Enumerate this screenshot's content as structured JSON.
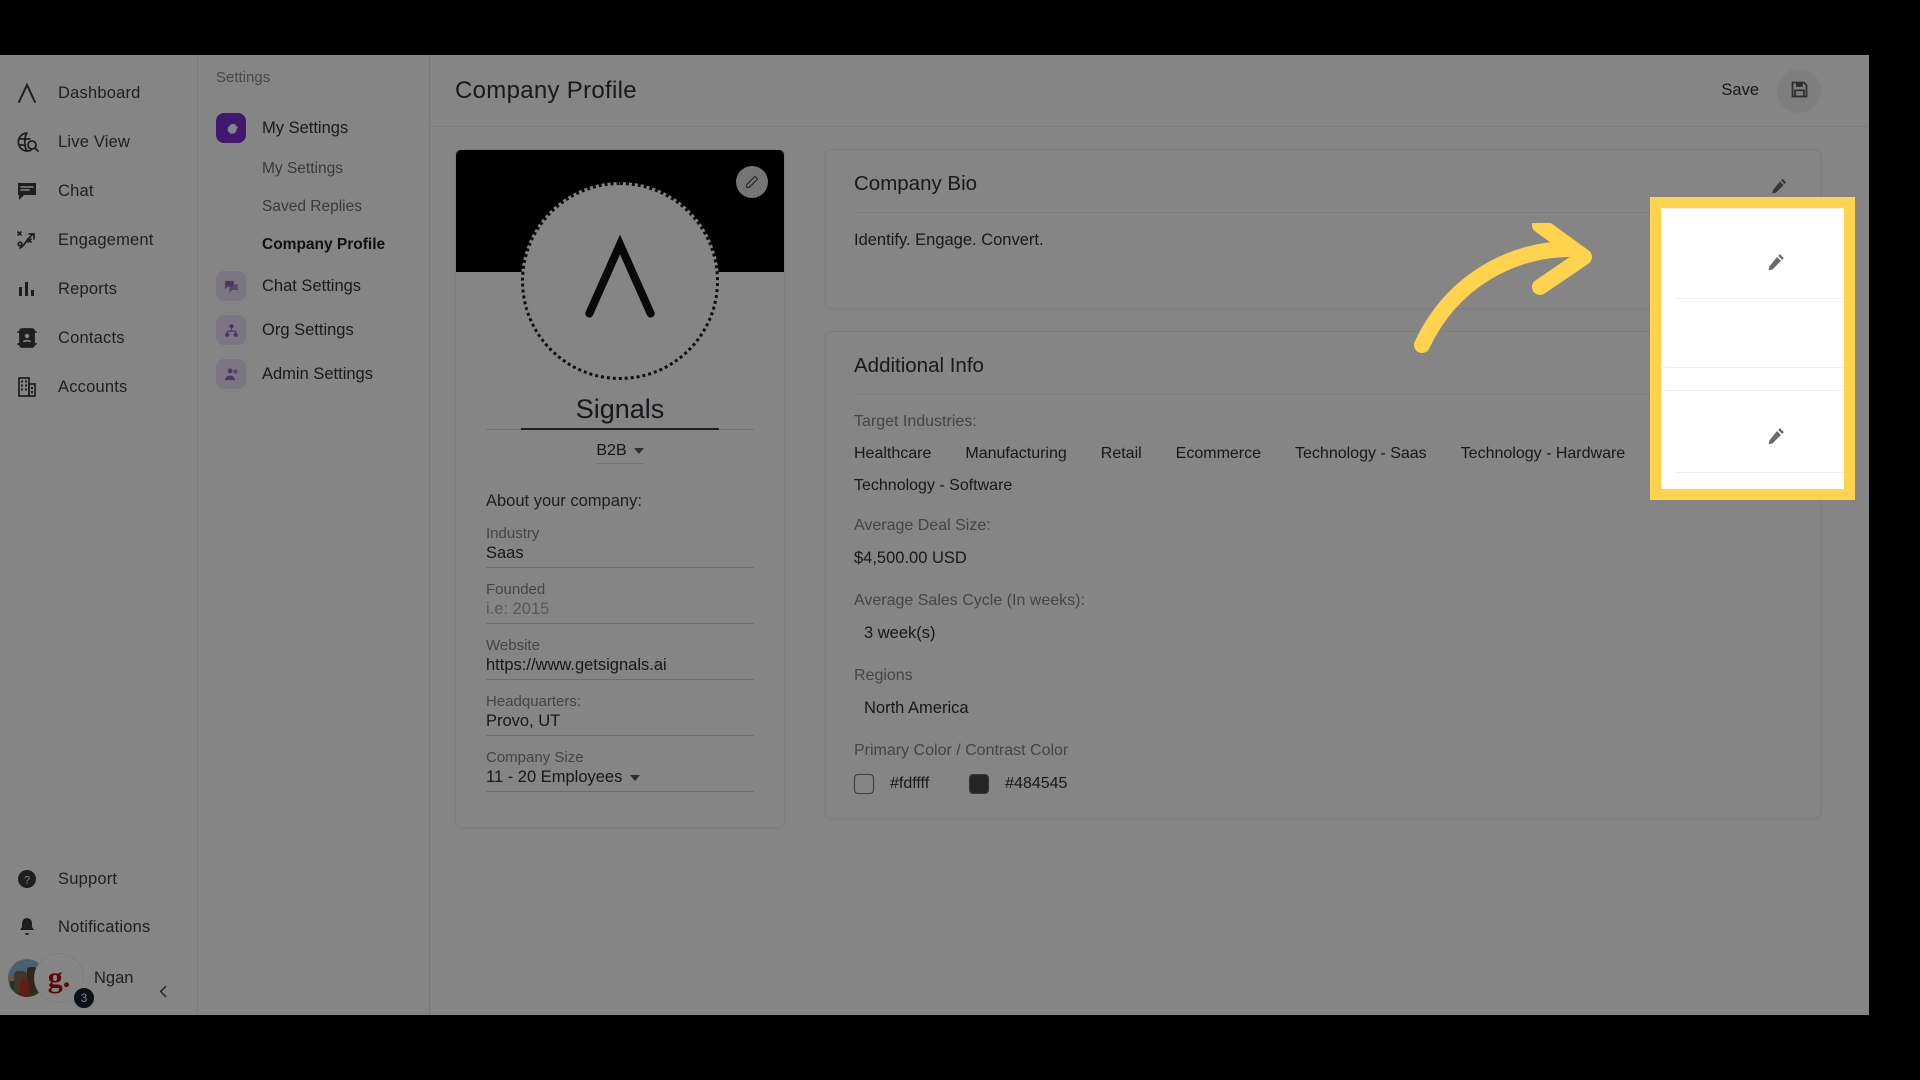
{
  "app": {
    "accent_purple": "#7b2fd4",
    "highlight_yellow": "#FFD34E"
  },
  "mainnav": {
    "items": [
      {
        "label": "Dashboard",
        "icon": "lambda-logo-icon"
      },
      {
        "label": "Live View",
        "icon": "globe-search-icon"
      },
      {
        "label": "Chat",
        "icon": "chat-bubble-icon"
      },
      {
        "label": "Engagement",
        "icon": "engagement-play-icon"
      },
      {
        "label": "Reports",
        "icon": "bar-chart-icon"
      },
      {
        "label": "Contacts",
        "icon": "contact-card-icon"
      },
      {
        "label": "Accounts",
        "icon": "building-icon"
      }
    ],
    "bottom": [
      {
        "label": "Support",
        "icon": "help-circle-icon"
      },
      {
        "label": "Notifications",
        "icon": "bell-icon"
      }
    ],
    "user": {
      "name": "Ngan",
      "badge_letter": "g.",
      "notification_count": "3"
    },
    "collapse_icon": "chevron-left-icon"
  },
  "subnav": {
    "title": "Settings",
    "items": [
      {
        "label": "My Settings",
        "icon": "gear-icon",
        "active": true
      },
      {
        "label": "Chat Settings",
        "icon": "chat-settings-icon",
        "active": false
      },
      {
        "label": "Org Settings",
        "icon": "org-settings-icon",
        "active": false
      },
      {
        "label": "Admin Settings",
        "icon": "admin-settings-icon",
        "active": false
      }
    ],
    "children": [
      {
        "label": "My Settings",
        "current": false
      },
      {
        "label": "Saved Replies",
        "current": false
      },
      {
        "label": "Company Profile",
        "current": true
      }
    ]
  },
  "header": {
    "title": "Company Profile",
    "save_label": "Save",
    "save_icon": "floppy-disk-icon"
  },
  "profile_card": {
    "banner_edit_icon": "pencil-icon",
    "logo_icon": "lambda-logo-icon",
    "company_name": "Signals",
    "business_type": "B2B",
    "about_title": "About your company:",
    "fields": [
      {
        "label": "Industry",
        "value": "Saas",
        "placeholder": false,
        "dropdown": false
      },
      {
        "label": "Founded",
        "value": "i.e: 2015",
        "placeholder": true,
        "dropdown": false
      },
      {
        "label": "Website",
        "value": "https://www.getsignals.ai",
        "placeholder": false,
        "dropdown": false
      },
      {
        "label": "Headquarters:",
        "value": "Provo, UT",
        "placeholder": false,
        "dropdown": false
      },
      {
        "label": "Company Size",
        "value": "11 - 20 Employees",
        "placeholder": false,
        "dropdown": true
      }
    ]
  },
  "bio_card": {
    "title": "Company Bio",
    "edit_icon": "pencil-icon",
    "text": "Identify. Engage. Convert."
  },
  "additional_info": {
    "title": "Additional Info",
    "edit_icon": "pencil-icon",
    "target_industries_label": "Target Industries:",
    "target_industries": [
      "Healthcare",
      "Manufacturing",
      "Retail",
      "Ecommerce",
      "Technology - Saas",
      "Technology - Hardware",
      "Technology - Software"
    ],
    "deal_size_label": "Average Deal Size:",
    "deal_size_value": "$4,500.00 USD",
    "sales_cycle_label": "Average Sales Cycle (In weeks):",
    "sales_cycle_value": "3 week(s)",
    "regions_label": "Regions",
    "regions_value": "North America",
    "colors_label": "Primary Color / Contrast Color",
    "primary_color": "#fdffff",
    "contrast_color": "#484545"
  },
  "annotation": {
    "arrow_icon": "curved-arrow-right-icon",
    "highlight_color": "#FFD34E"
  }
}
